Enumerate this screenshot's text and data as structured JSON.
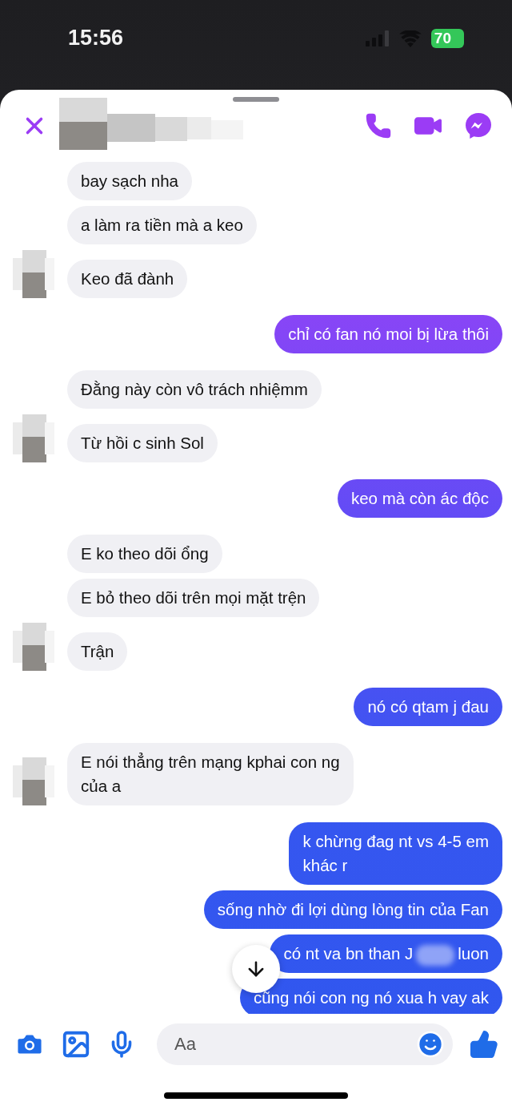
{
  "status_bar": {
    "time": "15:56",
    "battery": "70"
  },
  "messages": [
    {
      "outgoing": false,
      "kind": "text",
      "text": "bay sạch nha"
    },
    {
      "outgoing": false,
      "kind": "text",
      "text": "a làm ra tiền mà a keo"
    },
    {
      "outgoing": false,
      "kind": "text",
      "text": "Keo đã đành"
    },
    {
      "outgoing": true,
      "kind": "text",
      "text": "chỉ có fan nó moi bị lừa thôi"
    },
    {
      "outgoing": false,
      "kind": "text",
      "text": "Đằng này còn vô trách nhiệmm"
    },
    {
      "outgoing": false,
      "kind": "text",
      "text": "Từ hồi c sinh Sol"
    },
    {
      "outgoing": true,
      "kind": "text",
      "text": "keo mà còn ác độc"
    },
    {
      "outgoing": false,
      "kind": "text",
      "text": "E ko theo dõi ổng"
    },
    {
      "outgoing": false,
      "kind": "text",
      "text": "E bỏ theo dõi trên mọi mặt trện"
    },
    {
      "outgoing": false,
      "kind": "text",
      "text": "Trận"
    },
    {
      "outgoing": true,
      "kind": "text",
      "text": "nó có qtam j đau"
    },
    {
      "outgoing": false,
      "kind": "text",
      "text": "E nói thẳng trên mạng kphai con ng\ncủa a"
    },
    {
      "outgoing": true,
      "kind": "text",
      "text": "k chừng đag nt vs 4-5 em\nkhác r"
    },
    {
      "outgoing": true,
      "kind": "text",
      "text": "sống nhờ đi lợi dùng lòng tin của Fan"
    },
    {
      "outgoing": true,
      "kind": "redacted",
      "text_before": "có nt va bn than J",
      "text_after": "luon"
    },
    {
      "outgoing": true,
      "kind": "text",
      "text": "cũng nói con ng nó xua h vay ak"
    }
  ],
  "composer": {
    "placeholder": "Aa"
  }
}
